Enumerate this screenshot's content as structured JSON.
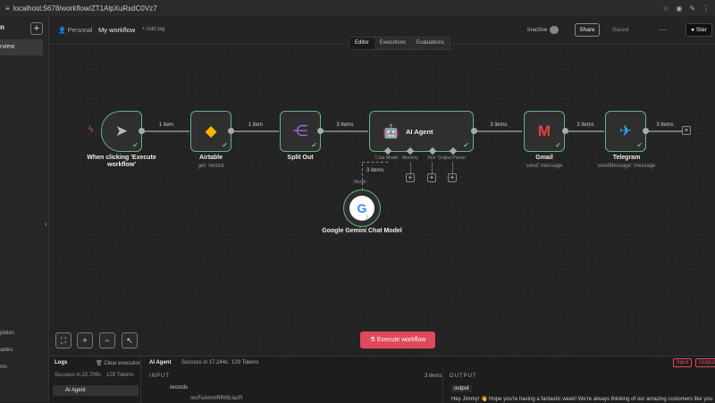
{
  "browser": {
    "url": "localhost:5678/workflow/ZT1AlpXuRsdC0Vz7"
  },
  "sidebar": {
    "logo_fragment": "n",
    "add_label": "+",
    "overview_label": "rview",
    "bottom_items": [
      "plates",
      "ables",
      "nts"
    ],
    "collapse_label": "‹"
  },
  "header": {
    "personal_label": "Personal",
    "workflow_name": "My workflow",
    "add_tag_label": "+ Add tag",
    "inactive_label": "Inactive",
    "share_label": "Share",
    "saved_label": "Saved",
    "more_label": "···",
    "star_label": "Star"
  },
  "tabs": [
    {
      "label": "Editor",
      "active": true
    },
    {
      "label": "Executions",
      "active": false
    },
    {
      "label": "Evaluations",
      "active": false
    }
  ],
  "nodes": {
    "trigger": {
      "label": "When clicking 'Execute workflow'"
    },
    "airtable": {
      "label": "Airtable",
      "sub": "get: record"
    },
    "split": {
      "label": "Split Out"
    },
    "agent": {
      "label": "AI Agent",
      "sub_inputs": [
        "Chat Model",
        "Memory",
        "Tool",
        "Output Parser"
      ]
    },
    "gmail": {
      "label": "Gmail",
      "sub": "send: message"
    },
    "telegram": {
      "label": "Telegram",
      "sub": "sendMessage: message"
    },
    "gemini": {
      "label": "Google Gemini Chat Model",
      "model_label": "Model",
      "count": "3"
    }
  },
  "connections": [
    "1 item",
    "1 item",
    "3 items",
    "3 items",
    "3 items",
    "3 items",
    "3 items"
  ],
  "canvas_controls": {
    "fit": "⛶",
    "zoom_in": "+",
    "zoom_out": "−",
    "pointer": "↖"
  },
  "execute_button": {
    "label": "Execute workflow"
  },
  "logs": {
    "title": "Logs",
    "clear_label": "Clear execution",
    "success": "Success in 22.709s",
    "tokens": "129 Tokens",
    "selected_node": "AI Agent",
    "detail_title": "AI Agent",
    "detail_success": "Success in 17.244s",
    "detail_tokens": "129 Tokens",
    "input_header": "INPUT",
    "items_count": "3 items",
    "output_header": "OUTPUT",
    "records_label": "records",
    "record_id": "recFoAmmRR08.lacR",
    "output_key": "output",
    "output_text": "Hey Jimmy! 👋 Hope you're having a fantastic week! We're always thinking of our amazing customers like you",
    "input_pill": "Input",
    "output_pill": "Output"
  },
  "colors": {
    "accent": "#e0495a",
    "success": "#5fb878"
  }
}
